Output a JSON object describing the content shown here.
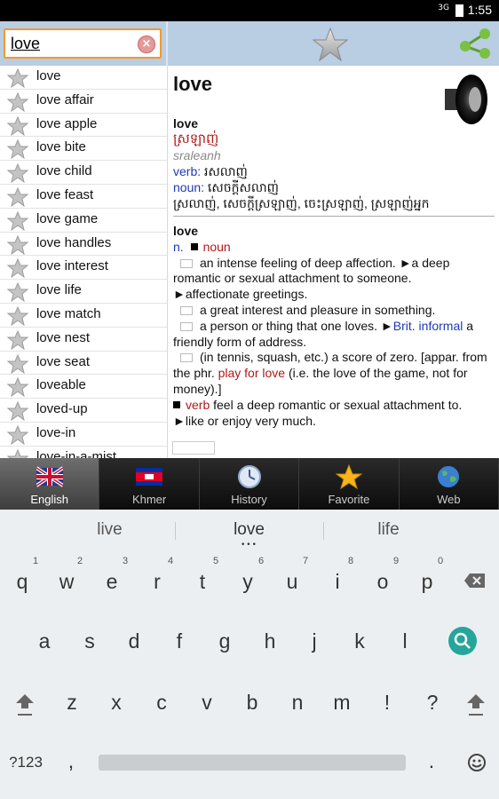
{
  "status_bar": {
    "time": "1:55",
    "signal": "3G"
  },
  "search": {
    "value": "love"
  },
  "word_list": [
    "love",
    "love affair",
    "love apple",
    "love bite",
    "love child",
    "love feast",
    "love game",
    "love handles",
    "love interest",
    "love life",
    "love match",
    "love nest",
    "love seat",
    "loveable",
    "loved-up",
    "love-in",
    "love-in-a-mist"
  ],
  "definition": {
    "title": "love",
    "entry1": {
      "headword": "love",
      "khmer": "ស្រឡាញ់",
      "romanized": "sraleanh",
      "verb_label": "verb:",
      "verb_text": " រសលាញ់",
      "noun_label": "noun:",
      "noun_text": " សេចក្តីសលាញ់",
      "extra": "ស្រលាញ់, សេចក្តីស្រឡាញ់, ចេះស្រឡាញ់, ស្រឡាញ់អ្នក"
    },
    "entry2": {
      "headword": "love",
      "n_label": "n.",
      "noun_label": "noun",
      "sense1": "an intense feeling of deep affection. ►a deep romantic or sexual attachment to someone.",
      "sense1b": "►affectionate greetings.",
      "sense2": "a great interest and pleasure in something.",
      "sense3a": "a person or thing that one loves. ►",
      "sense3_brit": "Brit. informal",
      "sense3b": " a friendly form of address.",
      "sense4a": "(in tennis, squash, etc.) a score of zero. [appar. from the phr. ",
      "sense4_phrase": "play for love",
      "sense4b": " (i.e. the love of the game, not for money).]",
      "verb_label": "verb",
      "verb_sense": " feel a deep romantic or sexual attachment to.",
      "verb_sense2": "►like or enjoy very much."
    }
  },
  "nav_tabs": [
    {
      "label": "English",
      "icon": "uk-flag-icon"
    },
    {
      "label": "Khmer",
      "icon": "cambodia-flag-icon"
    },
    {
      "label": "History",
      "icon": "clock-icon"
    },
    {
      "label": "Favorite",
      "icon": "star-icon"
    },
    {
      "label": "Web",
      "icon": "globe-icon"
    }
  ],
  "keyboard": {
    "suggestions": [
      "live",
      "love",
      "life"
    ],
    "row1": [
      "q",
      "w",
      "e",
      "r",
      "t",
      "y",
      "u",
      "i",
      "o",
      "p"
    ],
    "row1_hints": [
      "1",
      "2",
      "3",
      "4",
      "5",
      "6",
      "7",
      "8",
      "9",
      "0"
    ],
    "row2": [
      "a",
      "s",
      "d",
      "f",
      "g",
      "h",
      "j",
      "k",
      "l"
    ],
    "row3": [
      "z",
      "x",
      "c",
      "v",
      "b",
      "n",
      "m",
      "!",
      "?"
    ],
    "symbols_key": "?123",
    "comma_key": ",",
    "period_key": "."
  },
  "colors": {
    "accent_orange": "#f29a2e",
    "top_bar": "#b9cde3",
    "khmer_red": "#b01818",
    "pos_blue": "#1c3ab5",
    "search_key_teal": "#26a69a"
  }
}
